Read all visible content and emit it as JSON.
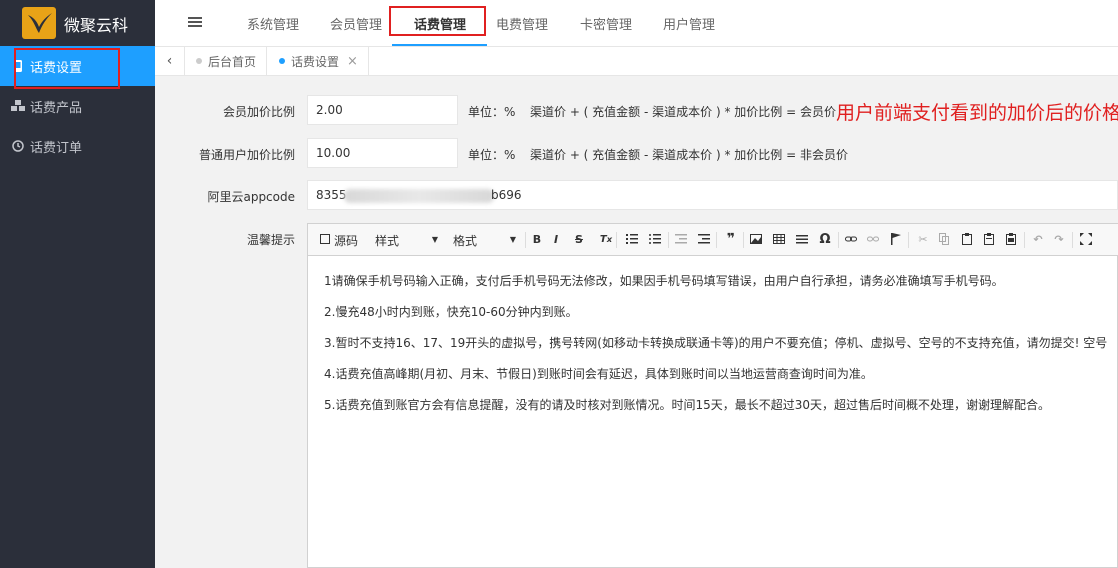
{
  "app": {
    "title": "微聚云科"
  },
  "sidebar": {
    "items": [
      {
        "label": "话费设置",
        "icon": "phone-icon",
        "active": true
      },
      {
        "label": "话费产品",
        "icon": "cubes-icon",
        "active": false
      },
      {
        "label": "话费订单",
        "icon": "clock-icon",
        "active": false
      }
    ]
  },
  "topnav": {
    "items": [
      {
        "label": "系统管理"
      },
      {
        "label": "会员管理"
      },
      {
        "label": "话费管理",
        "active": true
      },
      {
        "label": "电费管理"
      },
      {
        "label": "卡密管理"
      },
      {
        "label": "用户管理"
      }
    ]
  },
  "tabs": [
    {
      "label": "后台首页",
      "active": false
    },
    {
      "label": "话费设置",
      "active": true,
      "close": "×"
    }
  ],
  "form": {
    "member_markup": {
      "label": "会员加价比例",
      "value": "2.00",
      "unit": "单位：%",
      "formula": "渠道价 + ( 充值金额 - 渠道成本价 ) * 加价比例 = 会员价"
    },
    "user_markup": {
      "label": "普通用户加价比例",
      "value": "10.00",
      "unit": "单位：%",
      "formula": "渠道价 + ( 充值金额 - 渠道成本价 ) * 加价比例 = 非会员价"
    },
    "appcode": {
      "label": "阿里云appcode",
      "prefix": "8355",
      "suffix": "b696"
    },
    "notice": {
      "label": "温馨提示"
    }
  },
  "annotation": {
    "text": "用户前端支付看到的加价后的价格"
  },
  "editor": {
    "toolbar": {
      "source": "源码",
      "style": "样式",
      "format": "格式"
    },
    "paragraphs": [
      "1请确保手机号码输入正确，支付后手机号码无法修改，如果因手机号码填写错误，由用户自行承担，请务必准确填写手机号码。",
      "2.慢充48小时内到账，快充10-60分钟内到账。",
      "3.暂时不支持16、17、19开头的虚拟号，携号转网(如移动卡转换成联通卡等)的用户不要充值；停机、虚拟号、空号的不支持充值，请勿提交!      空号",
      "4.话费充值高峰期(月初、月末、节假日)到账时间会有延迟，具体到账时间以当地运营商查询时间为准。",
      "5.话费充值到账官方会有信息提醒，没有的请及时核对到账情况。时间15天，最长不超过30天，超过售后时间概不处理，谢谢理解配合。"
    ]
  },
  "colors": {
    "accent": "#1e9fff",
    "sidebar": "#2b2f3a",
    "annotation": "#e02020"
  }
}
